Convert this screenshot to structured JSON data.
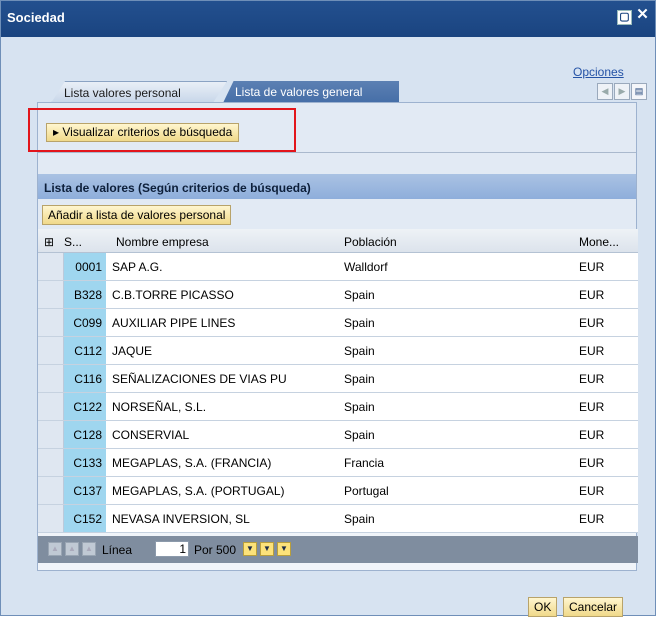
{
  "window": {
    "title": "Sociedad"
  },
  "opciones_label": "Opciones",
  "tabs": {
    "personal": "Lista valores personal",
    "general": "Lista de valores general"
  },
  "search_button": "Visualizar criterios de búsqueda",
  "list_title": "Lista de valores (Según criterios de búsqueda)",
  "add_button": "Añadir a lista de valores personal",
  "columns": {
    "code": "S...",
    "name": "Nombre empresa",
    "city": "Población",
    "currency": "Mone..."
  },
  "rows": [
    {
      "code": "0001",
      "name": "SAP A.G.",
      "city": "Walldorf",
      "currency": "EUR"
    },
    {
      "code": "B328",
      "name": "C.B.TORRE PICASSO",
      "city": "Spain",
      "currency": "EUR"
    },
    {
      "code": "C099",
      "name": "AUXILIAR PIPE LINES",
      "city": "Spain",
      "currency": "EUR"
    },
    {
      "code": "C112",
      "name": "JAQUE",
      "city": "Spain",
      "currency": "EUR"
    },
    {
      "code": "C116",
      "name": "SEÑALIZACIONES DE VIAS PU",
      "city": "Spain",
      "currency": "EUR"
    },
    {
      "code": "C122",
      "name": "NORSEÑAL, S.L.",
      "city": "Spain",
      "currency": "EUR"
    },
    {
      "code": "C128",
      "name": "CONSERVIAL",
      "city": "Spain",
      "currency": "EUR"
    },
    {
      "code": "C133",
      "name": "MEGAPLAS, S.A. (FRANCIA)",
      "city": "Francia",
      "currency": "EUR"
    },
    {
      "code": "C137",
      "name": "MEGAPLAS, S.A. (PORTUGAL)",
      "city": "Portugal",
      "currency": "EUR"
    },
    {
      "code": "C152",
      "name": "NEVASA INVERSION, SL",
      "city": "Spain",
      "currency": "EUR"
    }
  ],
  "footer": {
    "line_label": "Línea",
    "line_value": "1",
    "per_label": "Por 500"
  },
  "buttons": {
    "ok": "OK",
    "cancel": "Cancelar"
  }
}
